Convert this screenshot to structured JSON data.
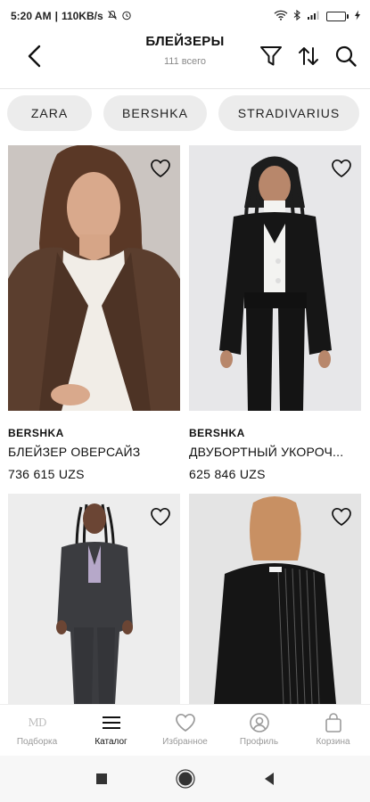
{
  "status_bar": {
    "time": "5:20 AM",
    "speed": "110KB/s",
    "battery_level": 0.8,
    "battery_color": "#2bb24c"
  },
  "header": {
    "title": "БЛЕЙЗЕРЫ",
    "subtitle": "111 всего"
  },
  "brand_chips": [
    "ZARA",
    "BERSHKA",
    "STRADIVARIUS"
  ],
  "products": [
    {
      "brand": "BERSHKA",
      "name": "БЛЕЙЗЕР ОВЕРСАЙЗ",
      "price": "736 615 UZS"
    },
    {
      "brand": "BERSHKA",
      "name": "ДВУБОРТНЫЙ УКОРОЧ...",
      "price": "625 846 UZS"
    },
    {
      "brand": "",
      "name": "",
      "price": ""
    },
    {
      "brand": "",
      "name": "",
      "price": ""
    }
  ],
  "bottom_nav": [
    {
      "label": "Подборка",
      "icon": "md-logo-icon",
      "logo_text": "MD"
    },
    {
      "label": "Каталог",
      "icon": "menu-icon"
    },
    {
      "label": "Избранное",
      "icon": "heart-icon"
    },
    {
      "label": "Профиль",
      "icon": "profile-icon"
    },
    {
      "label": "Корзина",
      "icon": "bag-icon"
    }
  ],
  "colors": {
    "active": "#111111",
    "inactive": "#9a9a9a",
    "chip_bg": "#ececec"
  }
}
